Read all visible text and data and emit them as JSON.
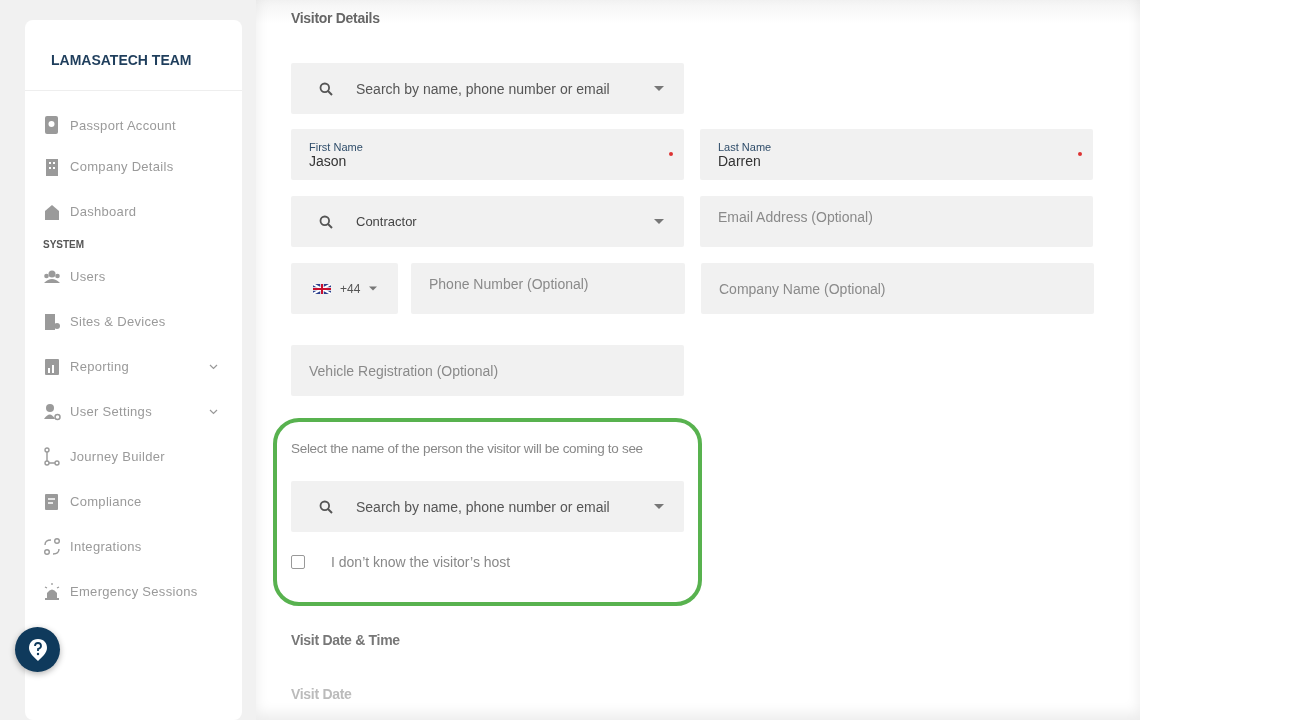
{
  "sidebar": {
    "team": "LAMASATECH TEAM",
    "top_items": [
      {
        "label": "Passport Account"
      },
      {
        "label": "Company Details"
      },
      {
        "label": "Dashboard"
      }
    ],
    "section_title": "SYSTEM",
    "items": [
      {
        "label": "Users",
        "kind": "link"
      },
      {
        "label": "Sites & Devices",
        "kind": "link"
      },
      {
        "label": "Reporting",
        "kind": "menu"
      },
      {
        "label": "User Settings",
        "kind": "menu"
      },
      {
        "label": "Journey Builder",
        "kind": "link"
      },
      {
        "label": "Compliance",
        "kind": "link"
      },
      {
        "label": "Integrations",
        "kind": "link"
      },
      {
        "label": "Emergency Sessions",
        "kind": "link"
      }
    ]
  },
  "visitor_details": {
    "title": "Visitor Details",
    "visitor_search": {
      "placeholder": "Search by name, phone number or email"
    },
    "first_name": {
      "label": "First Name",
      "value": "Jason",
      "required": true
    },
    "last_name": {
      "label": "Last Name",
      "value": "Darren",
      "required": true
    },
    "visitor_type": {
      "value": "Contractor"
    },
    "email": {
      "placeholder": "Email Address (Optional)"
    },
    "country_code": {
      "value": "+44"
    },
    "phone": {
      "placeholder": "Phone Number (Optional)"
    },
    "company": {
      "placeholder": "Company Name (Optional)"
    },
    "vehicle": {
      "placeholder": "Vehicle Registration (Optional)"
    }
  },
  "host": {
    "highlighted": true,
    "prompt": "Select the name of the person the visitor will be coming to see",
    "search": {
      "placeholder": "Search by name, phone number or email"
    },
    "unknown_host": {
      "label": "I don’t know the visitor’s host",
      "checked": false
    }
  },
  "visit": {
    "title": "Visit Date & Time",
    "date_label": "Visit Date"
  }
}
